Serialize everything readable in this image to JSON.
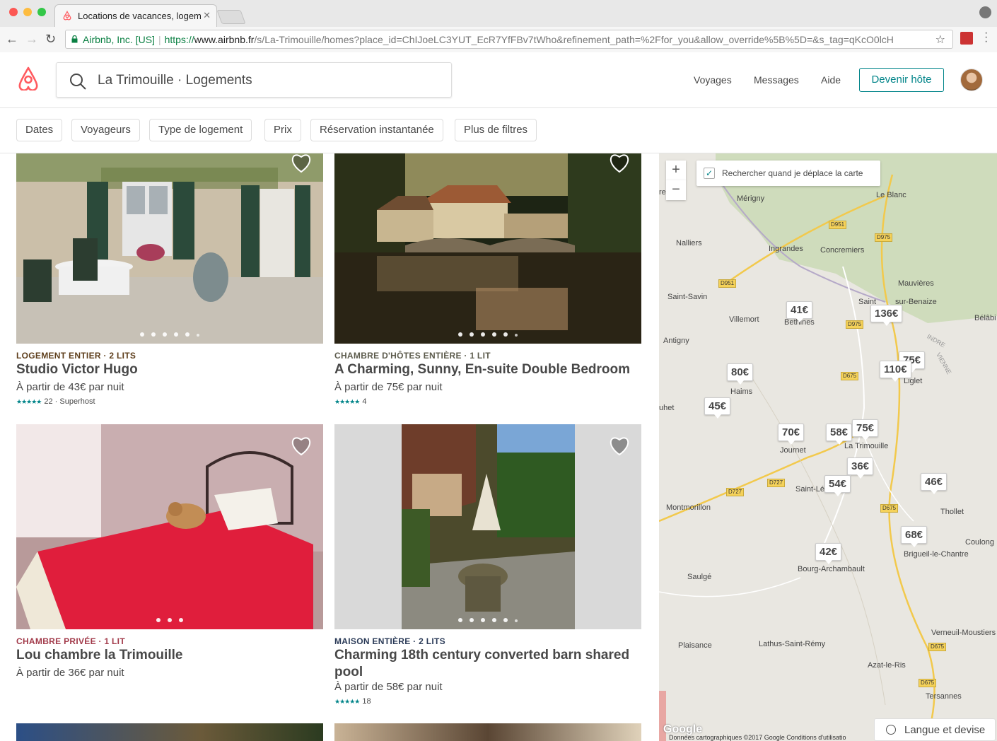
{
  "browser": {
    "tab_title": "Locations de vacances, logem",
    "url_org": "Airbnb, Inc. [US]",
    "url_scheme": "https://",
    "url_domain": "www.airbnb.fr",
    "url_rest": "/s/La-Trimouille/homes?place_id=ChIJoeLC3YUT_EcR7YfFBv7tWho&refinement_path=%2Ffor_you&allow_override%5B%5D=&s_tag=qKcO0lcH"
  },
  "header": {
    "search_text": "La Trimouille · Logements",
    "nav": [
      "Voyages",
      "Messages",
      "Aide"
    ],
    "host_button": "Devenir hôte"
  },
  "filters": [
    "Dates",
    "Voyageurs",
    "Type de logement",
    "Prix",
    "Réservation instantanée",
    "Plus de filtres"
  ],
  "listings": [
    {
      "kicker": "LOGEMENT ENTIER · 2 LITS",
      "kicker_color": "#5e3e1b",
      "title": "Studio Victor Hugo",
      "price": "À partir de 43€  par nuit",
      "rating_count": "22",
      "badge": "· Superhost"
    },
    {
      "kicker": "CHAMBRE D'HÔTES ENTIÈRE · 1 LIT",
      "kicker_color": "#5c5b4c",
      "title": "A Charming, Sunny, En-suite Double Bedroom",
      "price": "À partir de 75€  par nuit",
      "rating_count": "4",
      "badge": ""
    },
    {
      "kicker": "CHAMBRE PRIVÉE · 1 LIT",
      "kicker_color": "#a23a4a",
      "title": "Lou chambre la Trimouille",
      "price": "À partir de 36€  par nuit",
      "rating_count": "",
      "badge": ""
    },
    {
      "kicker": "MAISON ENTIÈRE · 2 LITS",
      "kicker_color": "#2b3b58",
      "title": "Charming 18th century converted barn shared pool",
      "price": "À partir de 58€  par nuit",
      "rating_count": "18",
      "badge": ""
    }
  ],
  "map": {
    "toggle_label": "Rechercher quand je déplace la carte",
    "zoom_in": "+",
    "zoom_out": "−",
    "pins": [
      "41€",
      "136€",
      "75€",
      "110€",
      "80€",
      "45€",
      "70€",
      "58€",
      "75€",
      "36€",
      "54€",
      "46€",
      "68€",
      "42€"
    ],
    "towns": [
      "Mérigny",
      "Le Blanc",
      "Nalliers",
      "Ingrandes",
      "Concremiers",
      "Saint-Savin",
      "Mauvières",
      "Saint",
      "sur-Benaize",
      "Villemort",
      "Bethines",
      "Bélâbi",
      "Antigny",
      "Haims",
      "Liglet",
      "uhet",
      "Journet",
      "La Trimouille",
      "Saint-Lé",
      "Montmorillon",
      "Thollet",
      "Brigueil-le-Chantre",
      "Coulong",
      "Saulgé",
      "Bourg-Archambault",
      "Plaisance",
      "Lathus-Saint-Rémy",
      "Verneuil-Moustiers",
      "Azat-le-Ris",
      "Tersannes",
      "INDRE",
      "VIENNE",
      "re"
    ],
    "roads": [
      "D951",
      "D975",
      "D951",
      "D975",
      "D675",
      "D727",
      "D727",
      "D675",
      "D675",
      "D675"
    ],
    "copyright": "Données cartographiques ©2017 Google     Conditions d'utilisatio",
    "google_mark": "Google",
    "lang_button": "Langue et devise"
  },
  "colors": {
    "brand": "#ff5a5f",
    "teal": "#008489"
  }
}
